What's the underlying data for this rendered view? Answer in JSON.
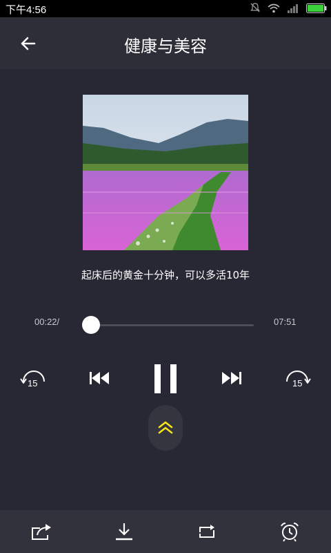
{
  "status_bar": {
    "time": "下午4:56",
    "icons": [
      "mute-icon",
      "wifi-icon",
      "signal-icon",
      "battery-icon"
    ],
    "battery_color": "#3ad13a"
  },
  "header": {
    "back_icon": "back-arrow-icon",
    "title": "健康与美容"
  },
  "player": {
    "track_title": "起床后的黄金十分钟，可以多活10年",
    "current_time": "00:22/",
    "total_time": "07:51",
    "progress_fraction": 0.047,
    "rewind_seconds": "15",
    "forward_seconds": "15",
    "state_icon": "pause-icon",
    "expand_color": "#f5e51b"
  },
  "toolbar": {
    "items": [
      "share-icon",
      "download-icon",
      "repeat-icon",
      "alarm-icon"
    ]
  },
  "colors": {
    "background": "#282834",
    "header_background": "#2e2e39",
    "toolbar_background": "#32323d",
    "accent": "#f5e51b"
  }
}
